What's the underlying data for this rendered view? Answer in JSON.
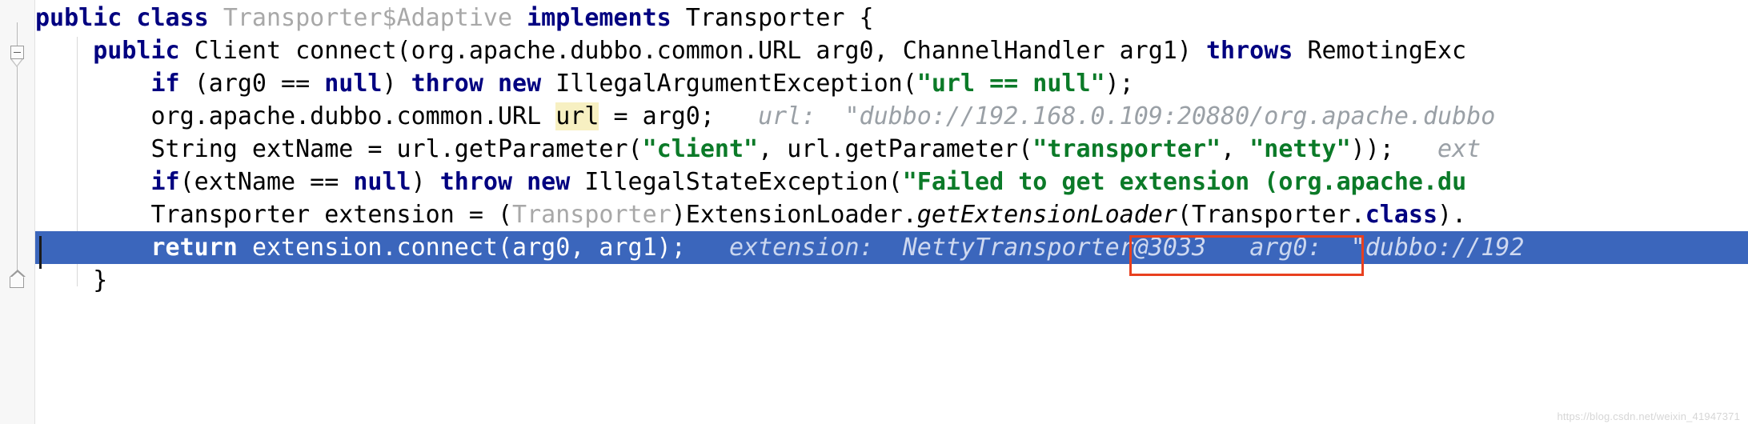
{
  "editor": {
    "app": "intellij-idea-debugger-editor",
    "language": "java",
    "colors": {
      "background": "#ffffff",
      "gutter": "#f7f7f7",
      "keyword": "#000080",
      "string": "#0b7a28",
      "comment_hint": "#9aa0a6",
      "selection": "#3b66bc",
      "annotation_box": "#e8401f",
      "identifier_highlight": "#f7f0c2"
    }
  },
  "gutter": {
    "fold_collapse_icon": "fold-minus-icon",
    "fold_region_start_icon": "fold-region-start-icon",
    "fold_region_end_icon": "fold-region-end-icon"
  },
  "code": {
    "lines": [
      {
        "id": "line-class-decl",
        "tokens": [
          {
            "t": "kw",
            "s": "public class "
          },
          {
            "t": "gray",
            "s": "Transporter$Adaptive "
          },
          {
            "t": "kw",
            "s": "implements "
          },
          {
            "t": "plain",
            "s": "Transporter {"
          }
        ]
      },
      {
        "id": "line-method-signature",
        "tokens": [
          {
            "t": "plain",
            "s": "    "
          },
          {
            "t": "kw",
            "s": "public "
          },
          {
            "t": "plain",
            "s": "Client connect(org.apache.dubbo.common.URL arg0, ChannelHandler arg1) "
          },
          {
            "t": "kw",
            "s": "throws "
          },
          {
            "t": "plain",
            "s": "RemotingExc"
          }
        ]
      },
      {
        "id": "line-null-check-arg0",
        "tokens": [
          {
            "t": "plain",
            "s": "        "
          },
          {
            "t": "kw",
            "s": "if "
          },
          {
            "t": "plain",
            "s": "(arg0 == "
          },
          {
            "t": "kw",
            "s": "null"
          },
          {
            "t": "plain",
            "s": ") "
          },
          {
            "t": "kw",
            "s": "throw new "
          },
          {
            "t": "plain",
            "s": "IllegalArgumentException("
          },
          {
            "t": "str",
            "s": "\"url == null\""
          },
          {
            "t": "plain",
            "s": ");"
          }
        ]
      },
      {
        "id": "line-url-assignment",
        "tokens": [
          {
            "t": "plain",
            "s": "        "
          },
          {
            "t": "plain",
            "s": "org.apache.dubbo.common.URL "
          },
          {
            "t": "hl",
            "s": "url"
          },
          {
            "t": "plain",
            "s": " = arg0;   "
          },
          {
            "t": "hint",
            "s": "url:  "
          },
          {
            "t": "hintval",
            "s": "\"dubbo://192.168.0.109:20880/org.apache.dubbo"
          }
        ]
      },
      {
        "id": "line-extname-assignment",
        "tokens": [
          {
            "t": "plain",
            "s": "        "
          },
          {
            "t": "plain",
            "s": "String extName = url.getParameter("
          },
          {
            "t": "str",
            "s": "\"client\""
          },
          {
            "t": "plain",
            "s": ", url.getParameter("
          },
          {
            "t": "str",
            "s": "\"transporter\""
          },
          {
            "t": "plain",
            "s": ", "
          },
          {
            "t": "str",
            "s": "\"netty\""
          },
          {
            "t": "plain",
            "s": "));   "
          },
          {
            "t": "hint",
            "s": "ext"
          }
        ]
      },
      {
        "id": "line-null-check-extname",
        "tokens": [
          {
            "t": "plain",
            "s": "        "
          },
          {
            "t": "kw",
            "s": "if"
          },
          {
            "t": "plain",
            "s": "(extName == "
          },
          {
            "t": "kw",
            "s": "null"
          },
          {
            "t": "plain",
            "s": ") "
          },
          {
            "t": "kw",
            "s": "throw new "
          },
          {
            "t": "plain",
            "s": "IllegalStateException("
          },
          {
            "t": "str",
            "s": "\"Failed to get extension (org.apache.du"
          }
        ]
      },
      {
        "id": "line-extension-loader",
        "tokens": [
          {
            "t": "plain",
            "s": "        "
          },
          {
            "t": "plain",
            "s": "Transporter extension = ("
          },
          {
            "t": "gray",
            "s": "Transporter"
          },
          {
            "t": "plain",
            "s": ")ExtensionLoader."
          },
          {
            "t": "meth",
            "s": "getExtensionLoader"
          },
          {
            "t": "plain",
            "s": "(Transporter."
          },
          {
            "t": "kw",
            "s": "class"
          },
          {
            "t": "plain",
            "s": ")."
          }
        ]
      },
      {
        "id": "line-return-connect",
        "selected": true,
        "tokens": [
          {
            "t": "plain",
            "s": "        "
          },
          {
            "t": "kw",
            "s": "return "
          },
          {
            "t": "plain",
            "s": "extension.connect(arg0, arg1);   "
          },
          {
            "t": "hint",
            "s": "extension:  "
          },
          {
            "t": "hintval",
            "s": "NettyTransporter@3033"
          },
          {
            "t": "hint",
            "s": "   arg0:  "
          },
          {
            "t": "hintval",
            "s": "\"dubbo://192"
          }
        ]
      },
      {
        "id": "line-closing-brace",
        "tokens": [
          {
            "t": "plain",
            "s": "    }"
          }
        ]
      }
    ]
  },
  "annotation": {
    "red_box_target": "NettyTransporter@3033",
    "label": "highlighted-extension-instance"
  },
  "watermark": {
    "text": "https://blog.csdn.net/weixin_41947371"
  }
}
